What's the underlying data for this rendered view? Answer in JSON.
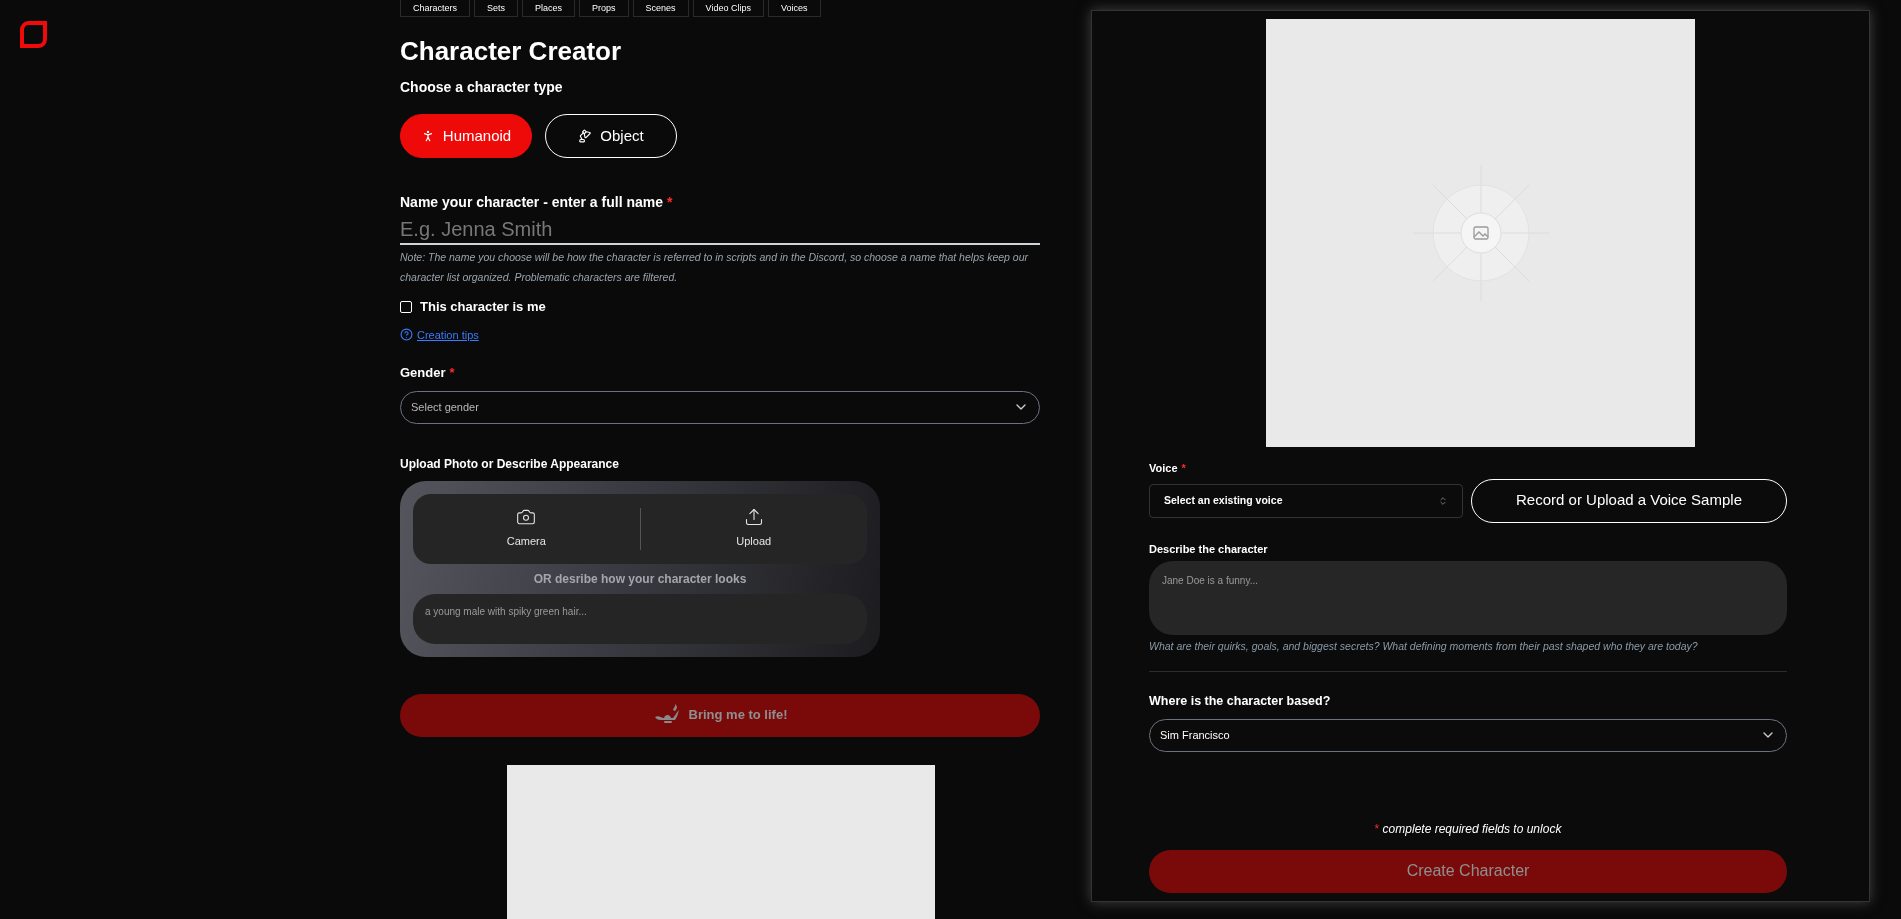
{
  "nav_tabs": [
    {
      "label": "Characters"
    },
    {
      "label": "Sets"
    },
    {
      "label": "Places"
    },
    {
      "label": "Props"
    },
    {
      "label": "Scenes"
    },
    {
      "label": "Video Clips"
    },
    {
      "label": "Voices"
    }
  ],
  "title": "Character Creator",
  "type_section": {
    "label": "Choose a character type",
    "options": [
      {
        "label": "Humanoid",
        "kind": "humanoid",
        "selected": true
      },
      {
        "label": "Object",
        "kind": "object",
        "selected": false
      }
    ]
  },
  "name_field": {
    "label": "Name your character - enter a full name",
    "required_mark": "*",
    "placeholder": "E.g. Jenna Smith",
    "note": "Note: The name you choose will be how the character is referred to in scripts and in the Discord, so choose a name that helps keep our character list organized. Problematic characters are filtered."
  },
  "self_checkbox": {
    "label": "This character is me",
    "checked": false
  },
  "tips_link": "Creation tips",
  "gender": {
    "label": "Gender",
    "required_mark": "*",
    "placeholder": "Select gender"
  },
  "appearance": {
    "label": "Upload Photo or Describe Appearance",
    "actions": [
      {
        "label": "Camera",
        "kind": "camera"
      },
      {
        "label": "Upload",
        "kind": "upload"
      }
    ],
    "or_text": "OR desribe how your character looks",
    "placeholder": "a young male with spiky green hair..."
  },
  "bring_button": {
    "label": "Bring me to life!",
    "disabled": true
  },
  "voice": {
    "label": "Voice",
    "required_mark": "*",
    "placeholder": "Select an existing voice",
    "record_button": "Record or Upload a Voice Sample"
  },
  "description": {
    "label": "Describe the character",
    "placeholder": "Jane Doe is a funny...",
    "hint": "What are their quirks, goals, and biggest secrets? What defining moments from their past shaped who they are today?"
  },
  "location": {
    "label": "Where is the character based?",
    "value": "Sim Francisco"
  },
  "required_note": {
    "mark": "*",
    "text": "complete required fields to unlock"
  },
  "create_button": {
    "label": "Create Character",
    "disabled": true
  }
}
